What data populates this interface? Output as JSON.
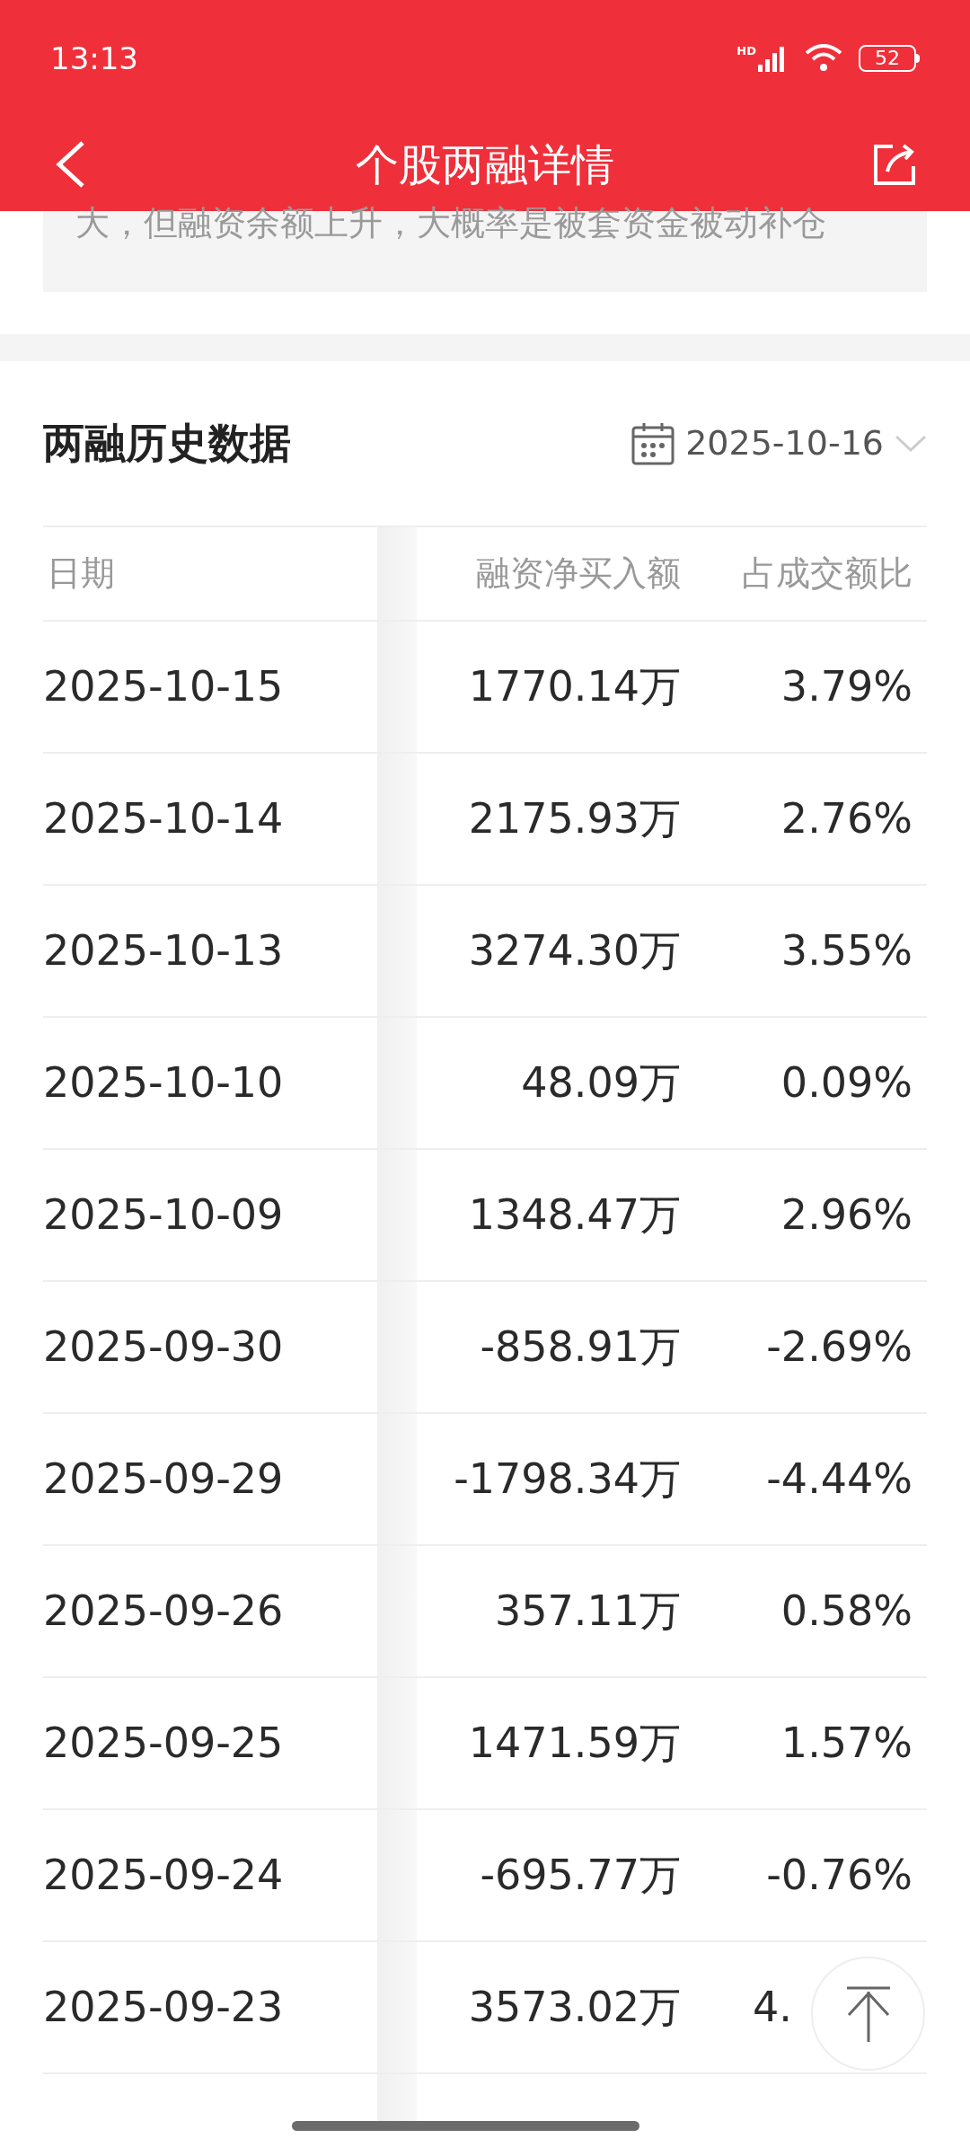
{
  "status_bar": {
    "time": "13:13",
    "network": "HD",
    "battery": "52"
  },
  "header": {
    "title": "个股两融详情"
  },
  "note": {
    "text": "大，但融资余额上升，大概率是被套资金被动补仓"
  },
  "history": {
    "title": "两融历史数据",
    "date": "2025-10-16",
    "columns": [
      "日期",
      "融资净买入额",
      "占成交额比"
    ],
    "rows": [
      {
        "date": "2025-10-15",
        "net_buy": "1770.14万",
        "ratio": "3.79%"
      },
      {
        "date": "2025-10-14",
        "net_buy": "2175.93万",
        "ratio": "2.76%"
      },
      {
        "date": "2025-10-13",
        "net_buy": "3274.30万",
        "ratio": "3.55%"
      },
      {
        "date": "2025-10-10",
        "net_buy": "48.09万",
        "ratio": "0.09%"
      },
      {
        "date": "2025-10-09",
        "net_buy": "1348.47万",
        "ratio": "2.96%"
      },
      {
        "date": "2025-09-30",
        "net_buy": "-858.91万",
        "ratio": "-2.69%"
      },
      {
        "date": "2025-09-29",
        "net_buy": "-1798.34万",
        "ratio": "-4.44%"
      },
      {
        "date": "2025-09-26",
        "net_buy": "357.11万",
        "ratio": "0.58%"
      },
      {
        "date": "2025-09-25",
        "net_buy": "1471.59万",
        "ratio": "1.57%"
      },
      {
        "date": "2025-09-24",
        "net_buy": "-695.77万",
        "ratio": "-0.76%"
      },
      {
        "date": "2025-09-23",
        "net_buy": "3573.02万",
        "ratio": "4.",
        "partial": true
      }
    ]
  }
}
